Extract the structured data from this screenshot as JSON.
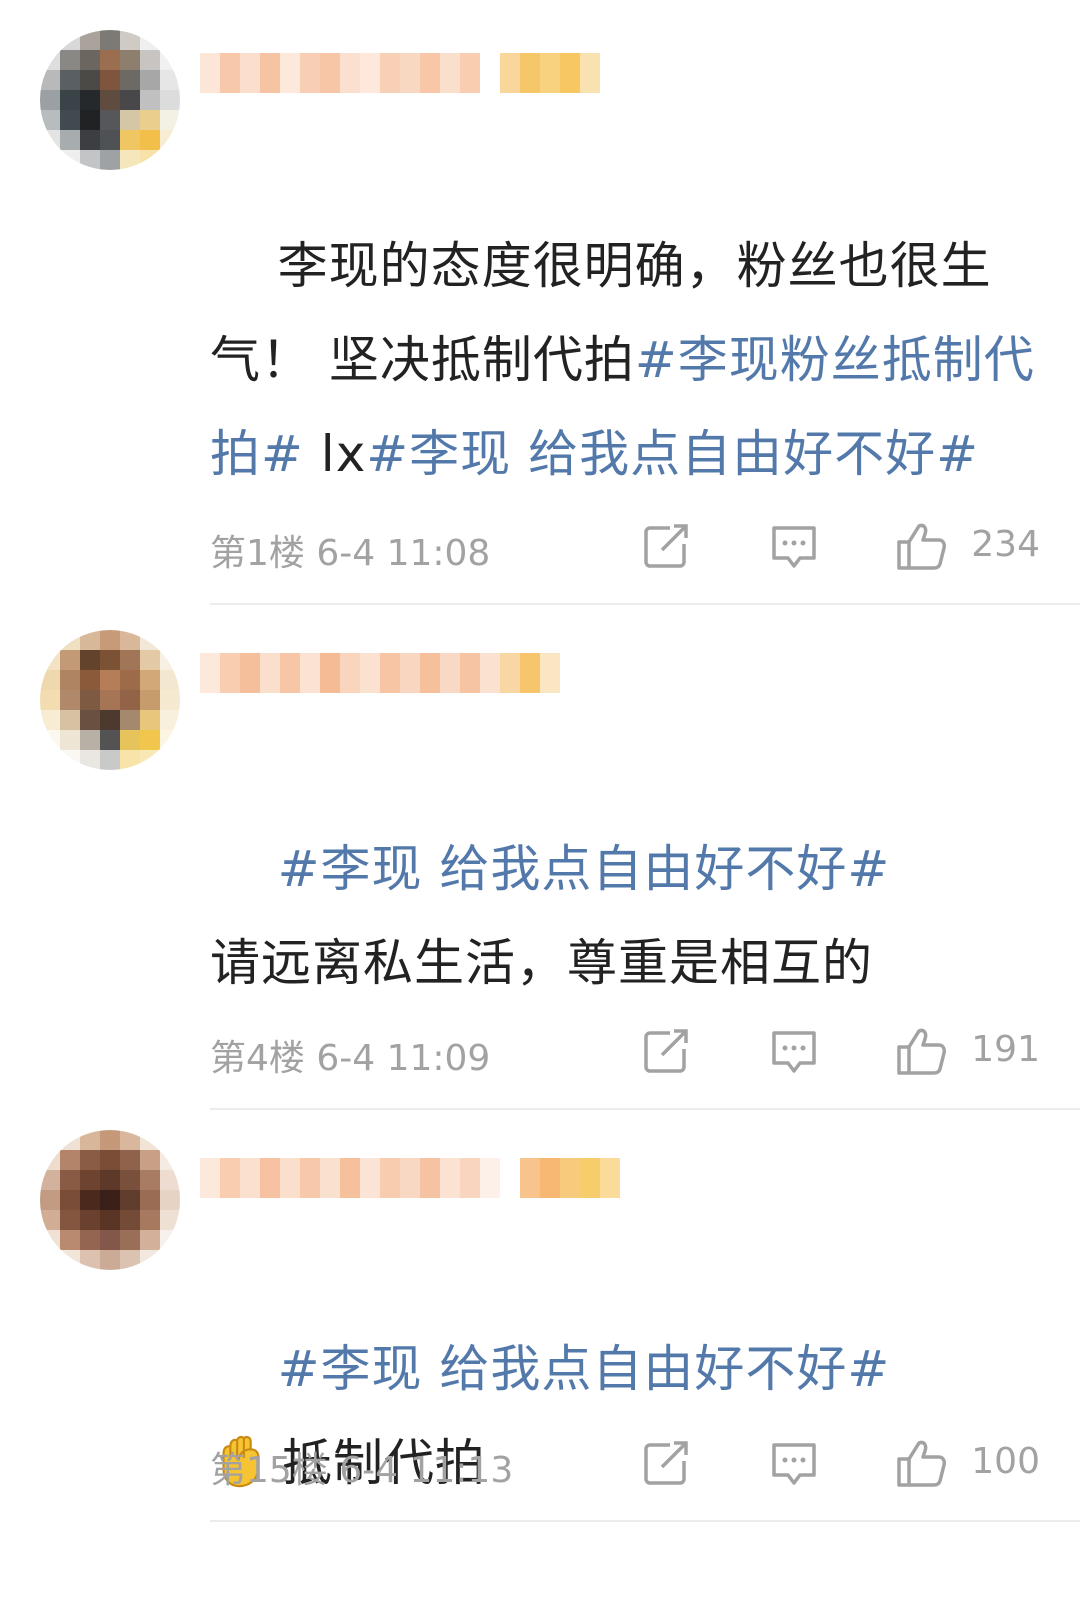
{
  "comments": [
    {
      "segments": [
        {
          "type": "plain",
          "text": "李现的态度很明确，粉丝也很生气！ 坚决抵制代拍"
        },
        {
          "type": "tag",
          "text": "#李现粉丝抵制代拍#"
        },
        {
          "type": "plain",
          "text": " lx"
        },
        {
          "type": "tag",
          "text": "#李现 给我点自由好不好#"
        }
      ],
      "floor_time": "第1楼  6-4 11:08",
      "likes": "234"
    },
    {
      "segments": [
        {
          "type": "tag",
          "text": "#李现 给我点自由好不好#"
        },
        {
          "type": "plain",
          "text": "请远离私生活，尊重是相互的"
        }
      ],
      "floor_time": "第4楼  6-4 11:09",
      "likes": "191"
    },
    {
      "segments": [
        {
          "type": "tag",
          "text": "#李现 给我点自由好不好#"
        },
        {
          "type": "plain",
          "text": "抵制代拍"
        }
      ],
      "floor_time": "第15楼  6-4 11:13",
      "likes": "100"
    }
  ],
  "icons": {
    "repost": "share-icon",
    "comment": "comment-icon",
    "like": "thumbs-up-icon",
    "emoji": "raised-fist-emoji"
  },
  "colors": {
    "hashtag": "#5379ab",
    "text": "#222222",
    "meta": "#a2a2a2"
  }
}
